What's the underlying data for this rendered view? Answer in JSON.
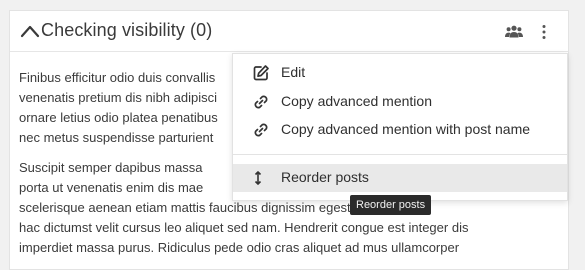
{
  "panel": {
    "title": "Checking visibility (0)",
    "collapse_icon": "chevron-up-icon",
    "members_icon": "users-icon",
    "more_icon": "kebab-menu-icon"
  },
  "body": {
    "paragraphs": [
      {
        "lines": [
          "Finibus efficitur odio duis convallis",
          "venenatis pretium dis nibh adipisci",
          "ornare letius odio platea penatibus",
          "nec metus suspendisse parturient"
        ]
      },
      {
        "lines": [
          "Suscipit semper dapibus massa",
          "porta ut venenatis enim dis mae",
          "scelerisque aenean etiam mattis faucibus dignissim egestas. Maximus",
          "hac dictumst velit cursus leo aliquet sed nam. Hendrerit congue est integer dis",
          "imperdiet massa purus. Ridiculus pede odio cras aliquet ad mus ullamcorper"
        ]
      }
    ]
  },
  "menu": {
    "items": [
      {
        "label": "Edit",
        "icon": "edit-icon"
      },
      {
        "label": "Copy advanced mention",
        "icon": "link-icon"
      },
      {
        "label": "Copy advanced mention with post name",
        "icon": "link-icon"
      },
      {
        "label": "Reorder posts",
        "icon": "reorder-icon",
        "hovered": true
      }
    ]
  },
  "tooltip": {
    "text": "Reorder posts"
  },
  "colors": {
    "background": "#f1f1f1",
    "card": "#ffffff",
    "hover": "#e9e9e9",
    "tooltip": "#2b2b2b"
  }
}
